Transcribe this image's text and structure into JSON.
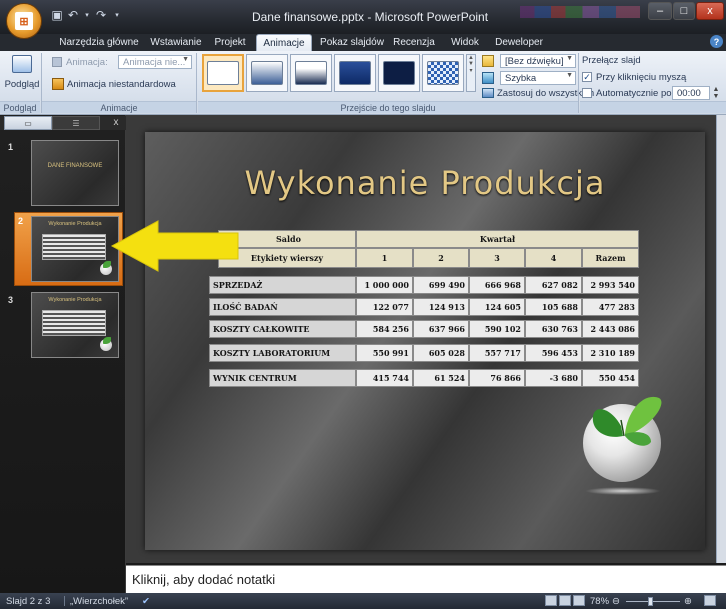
{
  "window": {
    "title": "Dane finansowe.pptx - Microsoft PowerPoint",
    "controls": {
      "minimize": "–",
      "maximize": "□",
      "close": "x"
    }
  },
  "office_button": {
    "icon": "office-logo-icon"
  },
  "quick_access": [
    {
      "name": "save-icon",
      "glyph": "💾"
    },
    {
      "name": "undo-icon",
      "glyph": "↶"
    },
    {
      "name": "redo-icon",
      "glyph": "↷"
    }
  ],
  "ribbon_tabs": [
    {
      "label": "Narzędzia główne",
      "active": false
    },
    {
      "label": "Wstawianie",
      "active": false
    },
    {
      "label": "Projekt",
      "active": false
    },
    {
      "label": "Animacje",
      "active": true
    },
    {
      "label": "Pokaz slajdów",
      "active": false
    },
    {
      "label": "Recenzja",
      "active": false
    },
    {
      "label": "Widok",
      "active": false
    },
    {
      "label": "Deweloper",
      "active": false
    }
  ],
  "ribbon": {
    "preview_group": {
      "button_label": "Podgląd",
      "group_label": "Podgląd"
    },
    "animations_group": {
      "animate_label": "Animacja:",
      "animate_value": "Animacja nie...",
      "custom_animation_label": "Animacja niestandardowa",
      "group_label": "Animacje"
    },
    "transition_group": {
      "group_label": "Przejście do tego slajdu",
      "sound_value": "[Bez dźwięku]",
      "speed_value": "Szybka",
      "apply_all_label": "Zastosuj do wszystkich"
    },
    "advance_group": {
      "heading": "Przełącz slajd",
      "on_click_label": "Przy kliknięciu myszą",
      "on_click_checked": true,
      "auto_label": "Automatycznie po:",
      "auto_checked": false,
      "auto_value": "00:00"
    }
  },
  "slides_pane": {
    "close_glyph": "x",
    "slides": [
      {
        "number": "1",
        "title": "DANE FINANSOWE",
        "selected": false
      },
      {
        "number": "2",
        "title": "Wykonanie Produkcja",
        "selected": true
      },
      {
        "number": "3",
        "title": "Wykonanie Produkcja",
        "selected": false
      }
    ]
  },
  "slide": {
    "title": "Wykonanie Produkcja",
    "table": {
      "header_top": {
        "left": "Saldo",
        "right": "Kwartał"
      },
      "header_row": [
        "Etykiety wierszy",
        "1",
        "2",
        "3",
        "4",
        "Razem"
      ],
      "rows": [
        [
          "SPRZEDAŻ",
          "1 000 000",
          "699 490",
          "666 968",
          "627 082",
          "2 993 540"
        ],
        [
          "ILOŚĆ BADAŃ",
          "122 077",
          "124 913",
          "124 605",
          "105 688",
          "477 283"
        ],
        [
          "KOSZTY CAŁKOWITE",
          "584 256",
          "637 966",
          "590 102",
          "630 763",
          "2 443 086"
        ],
        [
          "KOSZTY LABORATORIUM",
          "550 991",
          "605 028",
          "557 717",
          "596 453",
          "2 310 189"
        ],
        [
          "WYNIK CENTRUM",
          "415 744",
          "61 524",
          "76 866",
          "-3 680",
          "550 454"
        ]
      ]
    }
  },
  "notes": {
    "placeholder": "Kliknij, aby dodać notatki"
  },
  "status_bar": {
    "slide_info": "Slajd 2 z 3",
    "theme": "„Wierzchołek”",
    "zoom": "78%"
  },
  "colors": {
    "arrow": "#f4e010",
    "selected_thumb": "#e27a1c",
    "title_gold": "#e3c885"
  }
}
